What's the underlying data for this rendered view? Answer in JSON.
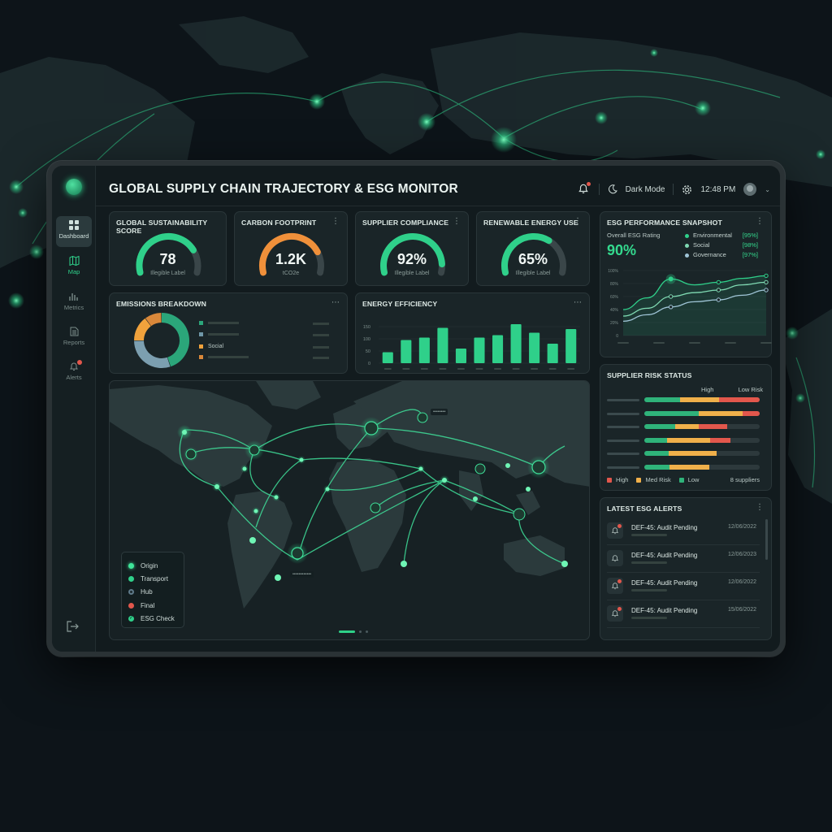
{
  "app": {
    "title": "GLOBAL SUPPLY CHAIN TRAJECTORY & ESG MONITOR",
    "mode_label": "Dark Mode",
    "time": "12:48 PM"
  },
  "sidebar": {
    "items": [
      {
        "label": "Dashboard",
        "icon": "grid-icon",
        "active": true
      },
      {
        "label": "Map",
        "icon": "map-icon"
      },
      {
        "label": "Metrics",
        "icon": "bar-chart-icon"
      },
      {
        "label": "Reports",
        "icon": "document-icon"
      },
      {
        "label": "Alerts",
        "icon": "bell-icon"
      }
    ]
  },
  "kpis": [
    {
      "title": "GLOBAL SUSTAINABILITY SCORE",
      "value": "78",
      "sub": "Illegible Label",
      "fraction": 0.78,
      "color": "#2fd08a"
    },
    {
      "title": "CARBON FOOTPRINT",
      "value": "1.2K",
      "sub": "tCO2e",
      "fraction": 0.8,
      "color": "#f0903a"
    },
    {
      "title": "SUPPLIER COMPLIANCE",
      "value": "92%",
      "sub": "Illegible Label",
      "fraction": 0.92,
      "color": "#2fd08a"
    },
    {
      "title": "RENEWABLE ENERGY USE",
      "value": "65%",
      "sub": "Illegible Label",
      "fraction": 0.65,
      "color": "#2fd08a"
    }
  ],
  "emissions": {
    "title": "EMISSIONS BREAKDOWN",
    "legend": [
      {
        "label": "Social",
        "color": "#f0a23c"
      }
    ],
    "legend_colors": [
      "#2ba67a",
      "#6f97a8",
      "#f0a23c",
      "#d9883a"
    ]
  },
  "energy": {
    "title": "ENERGY EFFICIENCY"
  },
  "snapshot": {
    "title": "ESG PERFORMANCE SNAPSHOT",
    "overall_label": "Overall ESG Rating",
    "overall_value": "90%",
    "legend": [
      {
        "label": "Environmental",
        "value": "[95%]",
        "color": "#2fd08a"
      },
      {
        "label": "Social",
        "value": "[98%]",
        "color": "#7fd9b2"
      },
      {
        "label": "Governance",
        "value": "[97%]",
        "color": "#9fc4d6"
      }
    ]
  },
  "risk": {
    "title": "SUPPLIER RISK STATUS",
    "high_label": "High",
    "low_label": "Low Risk",
    "rows": [
      [
        0.31,
        0.34,
        0.35
      ],
      [
        0.47,
        0.38,
        0.15
      ],
      [
        0.27,
        0.2,
        0.25
      ],
      [
        0.2,
        0.37,
        0.18
      ],
      [
        0.21,
        0.42,
        0
      ],
      [
        0.22,
        0.34,
        0
      ]
    ],
    "colors": {
      "low": "#2fb37a",
      "med": "#f0b04a",
      "high": "#e2574c"
    },
    "legend": [
      {
        "label": "High",
        "color": "#e2574c"
      },
      {
        "label": "Med Risk",
        "color": "#f0b04a"
      },
      {
        "label": "Low",
        "color": "#2fb37a"
      }
    ],
    "count": "8 suppliers"
  },
  "alerts": {
    "title": "LATEST ESG ALERTS",
    "items": [
      {
        "text": "DEF-45: Audit Pending",
        "date": "12/06/2022",
        "badge": true
      },
      {
        "text": "DEF-45: Audit Pending",
        "date": "12/06/2023",
        "badge": false
      },
      {
        "text": "DEF-45: Audit Pending",
        "date": "12/06/2022",
        "badge": true
      },
      {
        "text": "DEF-45: Audit Pending",
        "date": "15/06/2022",
        "badge": true
      }
    ]
  },
  "map": {
    "legend": [
      {
        "label": "Origin",
        "color": "#3fe59a"
      },
      {
        "label": "Transport",
        "color": "#2fd08a"
      },
      {
        "label": "Hub",
        "color": "#5f7a8a"
      },
      {
        "label": "Final",
        "color": "#e2574c"
      },
      {
        "label": "ESG Check",
        "color": "#2fd08a"
      }
    ]
  },
  "chart_data": [
    {
      "type": "bar",
      "title": "ENERGY EFFICIENCY",
      "ylim": [
        0,
        200
      ],
      "yticks": [
        0,
        50,
        100,
        150
      ],
      "values": [
        45,
        95,
        105,
        145,
        60,
        105,
        115,
        160,
        125,
        80,
        140
      ],
      "grid": true
    },
    {
      "type": "line",
      "title": "ESG PERFORMANCE SNAPSHOT",
      "ylim": [
        0,
        100
      ],
      "yticks": [
        "0",
        "20%",
        "40%",
        "60%",
        "80%",
        "100%"
      ],
      "series": [
        {
          "values": [
            40,
            58,
            87,
            78,
            82,
            88,
            92
          ],
          "color": "#2fd08a"
        },
        {
          "values": [
            30,
            42,
            60,
            66,
            70,
            78,
            82
          ],
          "color": "#7fd9b2"
        },
        {
          "values": [
            22,
            32,
            44,
            52,
            55,
            62,
            70
          ],
          "color": "#9fc4d6"
        }
      ]
    },
    {
      "type": "pie",
      "title": "EMISSIONS BREAKDOWN",
      "values": [
        45,
        30,
        15,
        10
      ],
      "colors": [
        "#2ba67a",
        "#7c9fb0",
        "#f0a23c",
        "#d9883a"
      ]
    }
  ]
}
